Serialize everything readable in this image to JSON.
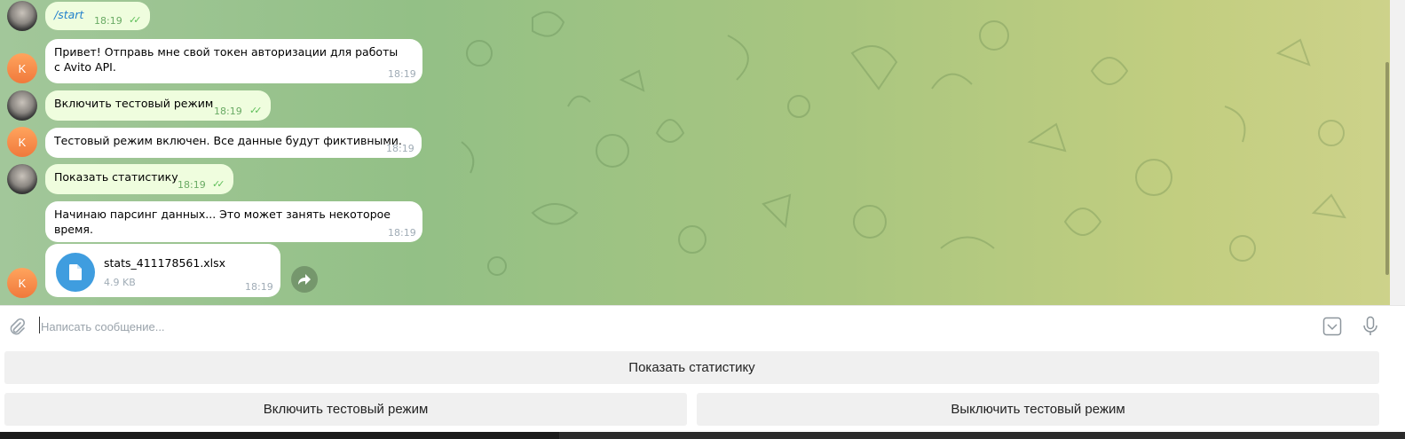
{
  "messages": [
    {
      "text": "/start",
      "time": "18:19"
    },
    {
      "text": "Привет! Отправь мне свой токен авторизации для работы с Avito API.",
      "time": "18:19"
    },
    {
      "text": "Включить тестовый режим",
      "time": "18:19"
    },
    {
      "text": "Тестовый режим включен. Все данные будут фиктивными.",
      "time": "18:19"
    },
    {
      "text": "Показать статистику",
      "time": "18:19"
    },
    {
      "text": "Начинаю парсинг данных... Это может занять некоторое время.",
      "time": "18:19"
    }
  ],
  "file": {
    "name": "stats_411178561.xlsx",
    "size": "4.9 KB",
    "time": "18:19"
  },
  "bot_avatar_letter": "K",
  "composer": {
    "placeholder": "Написать сообщение..."
  },
  "keyboard": {
    "row1": "Показать статистику",
    "row2_left": "Включить тестовый режим",
    "row2_right": "Выключить тестовый режим"
  },
  "colors": {
    "outgoing_bubble": "#effdde",
    "incoming_bubble": "#ffffff",
    "bot_avatar": "#f0793c",
    "file_icon": "#3f9ddf",
    "command_link": "#2481cc",
    "read_checks": "#5fbf5a"
  },
  "icons": [
    "paperclip-icon",
    "keyboard-toggle-icon",
    "microphone-icon",
    "file-icon",
    "share-icon",
    "double-check-icon"
  ]
}
